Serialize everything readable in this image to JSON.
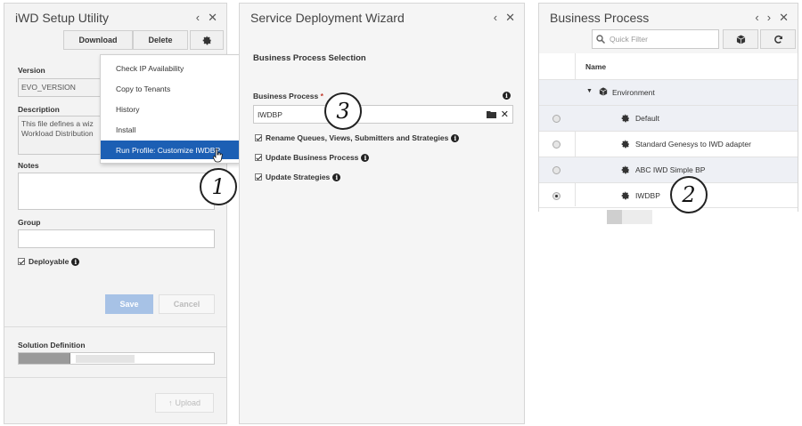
{
  "colors": {
    "selected_menu": "#1c5fb4",
    "save_button": "#a7c2e6"
  },
  "setup_utility": {
    "title": "iWD Setup Utility",
    "header_icons": [
      "chevron-left-icon",
      "close-icon"
    ],
    "download_label": "Download",
    "delete_label": "Delete",
    "version_label": "Version",
    "version_value": "EVO_VERSION",
    "description_label": "Description",
    "description_value": "This file defines a wiz\nWorkload Distribution",
    "notes_label": "Notes",
    "group_label": "Group",
    "deployable_label": "Deployable",
    "save_label": "Save",
    "cancel_label": "Cancel",
    "solution_label": "Solution Definition",
    "upload_label": "Upload",
    "menu": [
      "Check IP Availability",
      "Copy to Tenants",
      "History",
      "Install",
      "Run Profile: Customize IWDBP"
    ]
  },
  "wizard": {
    "title": "Service Deployment Wizard",
    "section": "Business Process Selection",
    "bp_label": "Business Process",
    "required_mark": "*",
    "bp_value": "IWDBP",
    "options": [
      "Rename Queues, Views, Submitters and Strategies",
      "Update Business Process",
      "Update Strategies"
    ]
  },
  "business_process": {
    "title": "Business Process",
    "filter_placeholder": "Quick Filter",
    "column_name": "Name",
    "root": "Environment",
    "rows": [
      {
        "label": "Default",
        "selected": false
      },
      {
        "label": "Standard Genesys to IWD adapter",
        "selected": false
      },
      {
        "label": "ABC IWD Simple BP",
        "selected": false
      },
      {
        "label": "IWDBP",
        "selected": true
      }
    ]
  },
  "steps": [
    "1",
    "2",
    "3"
  ]
}
